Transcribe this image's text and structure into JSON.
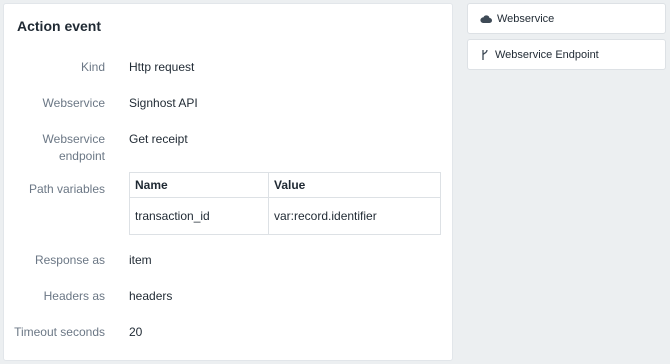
{
  "card": {
    "title": "Action event",
    "fields": {
      "kind": {
        "label": "Kind",
        "value": "Http request"
      },
      "webservice": {
        "label": "Webservice",
        "value": "Signhost API"
      },
      "endpoint": {
        "label_line1": "Webservice",
        "label_line2": "endpoint",
        "value": "Get receipt"
      },
      "path_variables": {
        "label": "Path variables",
        "columns": [
          "Name",
          "Value"
        ],
        "rows": [
          [
            "transaction_id",
            "var:record.identifier"
          ]
        ]
      },
      "response_as": {
        "label": "Response as",
        "value": "item"
      },
      "headers_as": {
        "label": "Headers as",
        "value": "headers"
      },
      "timeout": {
        "label": "Timeout seconds",
        "value": "20"
      }
    }
  },
  "sidebar": {
    "buttons": [
      {
        "label": "Webservice",
        "icon": "cloud-icon"
      },
      {
        "label": "Webservice Endpoint",
        "icon": "fork-icon"
      }
    ]
  }
}
